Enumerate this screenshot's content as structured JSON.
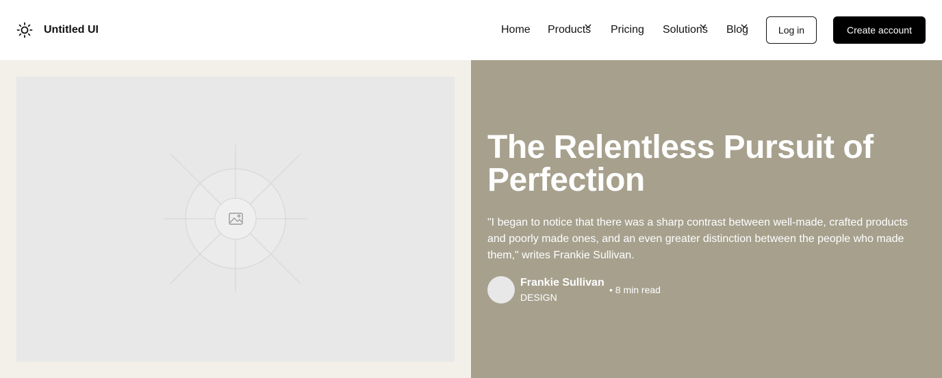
{
  "header": {
    "brand": "Untitled UI",
    "brand_icon": "sun-icon",
    "nav": [
      {
        "label": "Home",
        "has_dropdown": false
      },
      {
        "label": "Products",
        "has_dropdown": true
      },
      {
        "label": "Pricing",
        "has_dropdown": false
      },
      {
        "label": "Solutions",
        "has_dropdown": true
      },
      {
        "label": "Blog",
        "has_dropdown": true
      }
    ],
    "login_label": "Log in",
    "create_label": "Create account"
  },
  "hero": {
    "image_icon": "image-placeholder-icon",
    "title": "The Relentless Pursuit of Perfection",
    "quote": "\"I began to notice that there was a sharp contrast between well-made, crafted products and poorly made ones, and an even greater distinction between the people who made them,\" writes Frankie Sullivan.",
    "author": {
      "name": "Frankie Sullivan",
      "category": "DESIGN",
      "read_time": "• 8 min read"
    }
  },
  "colors": {
    "left_bg": "#f3f0e9",
    "right_bg": "#a6a08d",
    "placeholder_bg": "#e8e8e8",
    "button_dark": "#000000"
  }
}
